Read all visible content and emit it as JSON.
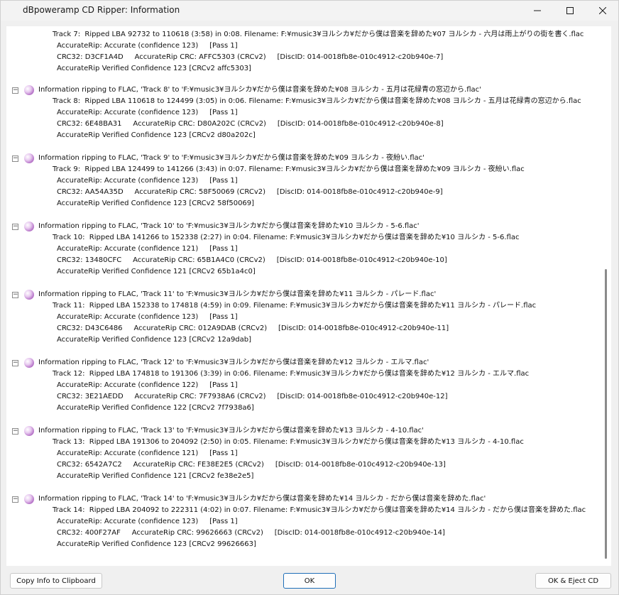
{
  "window": {
    "title": "dBpoweramp CD Ripper: Information",
    "controls": {
      "minimize": "–",
      "maximize": "□",
      "close": "✕"
    }
  },
  "log": {
    "intro": [
      "Track 7:  Ripped LBA 92732 to 110618 (3:58) in 0:08. Filename: F:¥music3¥ヨルシカ¥だから僕は音楽を辞めた¥07 ヨルシカ - 六月は雨上がりの街を書く.flac",
      "AccurateRip: Accurate (confidence 123)     [Pass 1]",
      "CRC32: D3CF1A4D     AccurateRip CRC: AFFC5303 (CRCv2)     [DiscID: 014-0018fb8e-010c4912-c20b940e-7]",
      "AccurateRip Verified Confidence 123 [CRCv2 affc5303]"
    ],
    "blocks": [
      {
        "header": "Information ripping to FLAC, 'Track 8' to 'F:¥music3¥ヨルシカ¥だから僕は音楽を辞めた¥08 ヨルシカ - 五月は花緑青の窓辺から.flac'",
        "lines": [
          "Track 8:  Ripped LBA 110618 to 124499 (3:05) in 0:06. Filename: F:¥music3¥ヨルシカ¥だから僕は音楽を辞めた¥08 ヨルシカ - 五月は花緑青の窓辺から.flac",
          "AccurateRip: Accurate (confidence 123)     [Pass 1]",
          "CRC32: 6E48BA31     AccurateRip CRC: D80A202C (CRCv2)     [DiscID: 014-0018fb8e-010c4912-c20b940e-8]",
          "AccurateRip Verified Confidence 123 [CRCv2 d80a202c]"
        ]
      },
      {
        "header": "Information ripping to FLAC, 'Track 9' to 'F:¥music3¥ヨルシカ¥だから僕は音楽を辞めた¥09 ヨルシカ - 夜紛い.flac'",
        "lines": [
          "Track 9:  Ripped LBA 124499 to 141266 (3:43) in 0:07. Filename: F:¥music3¥ヨルシカ¥だから僕は音楽を辞めた¥09 ヨルシカ - 夜紛い.flac",
          "AccurateRip: Accurate (confidence 123)     [Pass 1]",
          "CRC32: AA54A35D     AccurateRip CRC: 58F50069 (CRCv2)     [DiscID: 014-0018fb8e-010c4912-c20b940e-9]",
          "AccurateRip Verified Confidence 123 [CRCv2 58f50069]"
        ]
      },
      {
        "header": "Information ripping to FLAC, 'Track 10' to 'F:¥music3¥ヨルシカ¥だから僕は音楽を辞めた¥10 ヨルシカ - 5-6.flac'",
        "lines": [
          "Track 10:  Ripped LBA 141266 to 152338 (2:27) in 0:04. Filename: F:¥music3¥ヨルシカ¥だから僕は音楽を辞めた¥10 ヨルシカ - 5-6.flac",
          "AccurateRip: Accurate (confidence 121)     [Pass 1]",
          "CRC32: 13480CFC     AccurateRip CRC: 65B1A4C0 (CRCv2)     [DiscID: 014-0018fb8e-010c4912-c20b940e-10]",
          "AccurateRip Verified Confidence 121 [CRCv2 65b1a4c0]"
        ]
      },
      {
        "header": "Information ripping to FLAC, 'Track 11' to 'F:¥music3¥ヨルシカ¥だから僕は音楽を辞めた¥11 ヨルシカ - パレード.flac'",
        "lines": [
          "Track 11:  Ripped LBA 152338 to 174818 (4:59) in 0:09. Filename: F:¥music3¥ヨルシカ¥だから僕は音楽を辞めた¥11 ヨルシカ - パレード.flac",
          "AccurateRip: Accurate (confidence 123)     [Pass 1]",
          "CRC32: D43C6486     AccurateRip CRC: 012A9DAB (CRCv2)     [DiscID: 014-0018fb8e-010c4912-c20b940e-11]",
          "AccurateRip Verified Confidence 123 [CRCv2 12a9dab]"
        ]
      },
      {
        "header": "Information ripping to FLAC, 'Track 12' to 'F:¥music3¥ヨルシカ¥だから僕は音楽を辞めた¥12 ヨルシカ - エルマ.flac'",
        "lines": [
          "Track 12:  Ripped LBA 174818 to 191306 (3:39) in 0:06. Filename: F:¥music3¥ヨルシカ¥だから僕は音楽を辞めた¥12 ヨルシカ - エルマ.flac",
          "AccurateRip: Accurate (confidence 122)     [Pass 1]",
          "CRC32: 3E21AEDD     AccurateRip CRC: 7F7938A6 (CRCv2)     [DiscID: 014-0018fb8e-010c4912-c20b940e-12]",
          "AccurateRip Verified Confidence 122 [CRCv2 7f7938a6]"
        ]
      },
      {
        "header": "Information ripping to FLAC, 'Track 13' to 'F:¥music3¥ヨルシカ¥だから僕は音楽を辞めた¥13 ヨルシカ - 4-10.flac'",
        "lines": [
          "Track 13:  Ripped LBA 191306 to 204092 (2:50) in 0:05. Filename: F:¥music3¥ヨルシカ¥だから僕は音楽を辞めた¥13 ヨルシカ - 4-10.flac",
          "AccurateRip: Accurate (confidence 121)     [Pass 1]",
          "CRC32: 6542A7C2     AccurateRip CRC: FE38E2E5 (CRCv2)     [DiscID: 014-0018fb8e-010c4912-c20b940e-13]",
          "AccurateRip Verified Confidence 121 [CRCv2 fe38e2e5]"
        ]
      },
      {
        "header": "Information ripping to FLAC, 'Track 14' to 'F:¥music3¥ヨルシカ¥だから僕は音楽を辞めた¥14 ヨルシカ - だから僕は音楽を辞めた.flac'",
        "lines": [
          "Track 14:  Ripped LBA 204092 to 222311 (4:02) in 0:07. Filename: F:¥music3¥ヨルシカ¥だから僕は音楽を辞めた¥14 ヨルシカ - だから僕は音楽を辞めた.flac",
          "AccurateRip: Accurate (confidence 123)     [Pass 1]",
          "CRC32: 400F27AF     AccurateRip CRC: 99626663 (CRCv2)     [DiscID: 014-0018fb8e-010c4912-c20b940e-14]",
          "AccurateRip Verified Confidence 123 [CRCv2 99626663]"
        ]
      }
    ],
    "toggle_symbol": "−"
  },
  "buttons": {
    "copy": "Copy Info to Clipboard",
    "ok": "OK",
    "eject": "OK & Eject CD"
  }
}
